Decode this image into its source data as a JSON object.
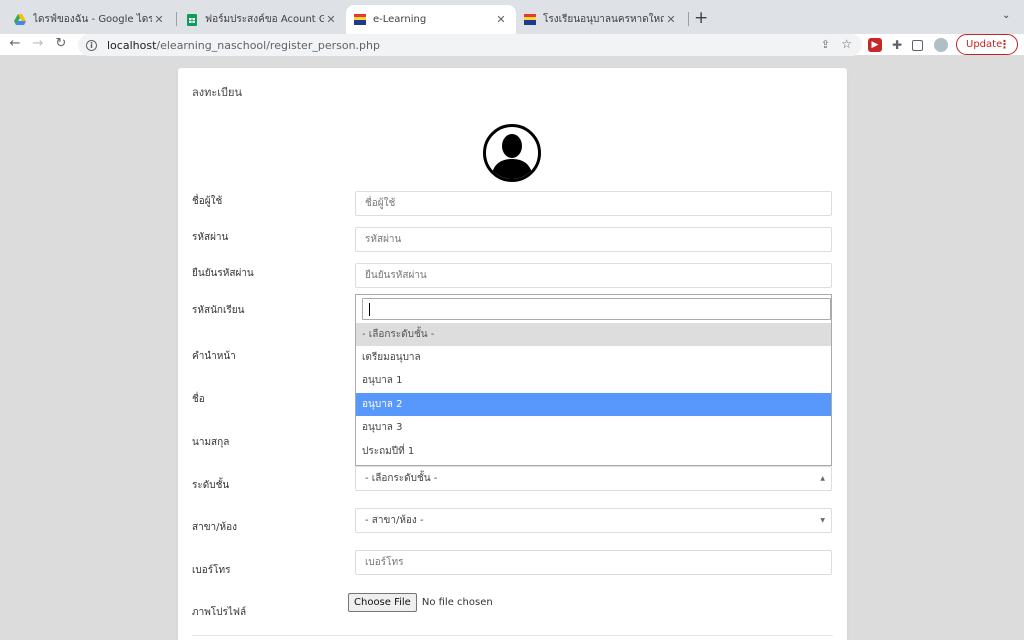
{
  "browser": {
    "tabs": [
      {
        "title": "ไดรฟ์ของฉัน - Google ไดรฟ์",
        "icon": "google-drive-icon"
      },
      {
        "title": "ฟอร์มประสงค์ขอ Acount Google",
        "icon": "google-sheets-icon"
      },
      {
        "title": "e-Learning",
        "icon": "school-logo-icon",
        "active": true
      },
      {
        "title": "โรงเรียนอนุบาลนครหาดใหญ่ (นะ ส",
        "icon": "school-logo-icon"
      }
    ],
    "url_host": "localhost",
    "url_path": "/elearning_naschool/register_person.php",
    "update_label": "Update"
  },
  "form": {
    "title": "ลงทะเบียน",
    "fields": {
      "username": {
        "label": "ชื่อผู้ใช้",
        "placeholder": "ชื่อผู้ใช้"
      },
      "password": {
        "label": "รหัสผ่าน",
        "placeholder": "รหัสผ่าน"
      },
      "confirm_password": {
        "label": "ยืนยันรหัสผ่าน",
        "placeholder": "ยืนยันรหัสผ่าน"
      },
      "student_id": {
        "label": "รหัสนักเรียน"
      },
      "prefix": {
        "label": "คำนำหน้า"
      },
      "first_name": {
        "label": "ชื่อ"
      },
      "last_name": {
        "label": "นามสกุล"
      },
      "grade_level": {
        "label": "ระดับชั้น",
        "value": "- เลือกระดับชั้น -"
      },
      "room": {
        "label": "สาขา/ห้อง",
        "value": "- สาขา/ห้อง -"
      },
      "phone": {
        "label": "เบอร์โทร",
        "placeholder": "เบอร์โทร"
      },
      "profile_image": {
        "label": "ภาพโปรไฟล์",
        "button": "Choose File",
        "status": "No file chosen"
      }
    },
    "dropdown_options": [
      "- เลือกระดับชั้น -",
      "เตรียมอนุบาล",
      "อนุบาล 1",
      "อนุบาล 2",
      "อนุบาล 3",
      "ประถมปีที่ 1"
    ],
    "dropdown_highlighted": "อนุบาล 2"
  },
  "colors": {
    "highlight": "#5897fb",
    "update_red": "#c5221f",
    "page_bg": "#dcdcdc"
  }
}
